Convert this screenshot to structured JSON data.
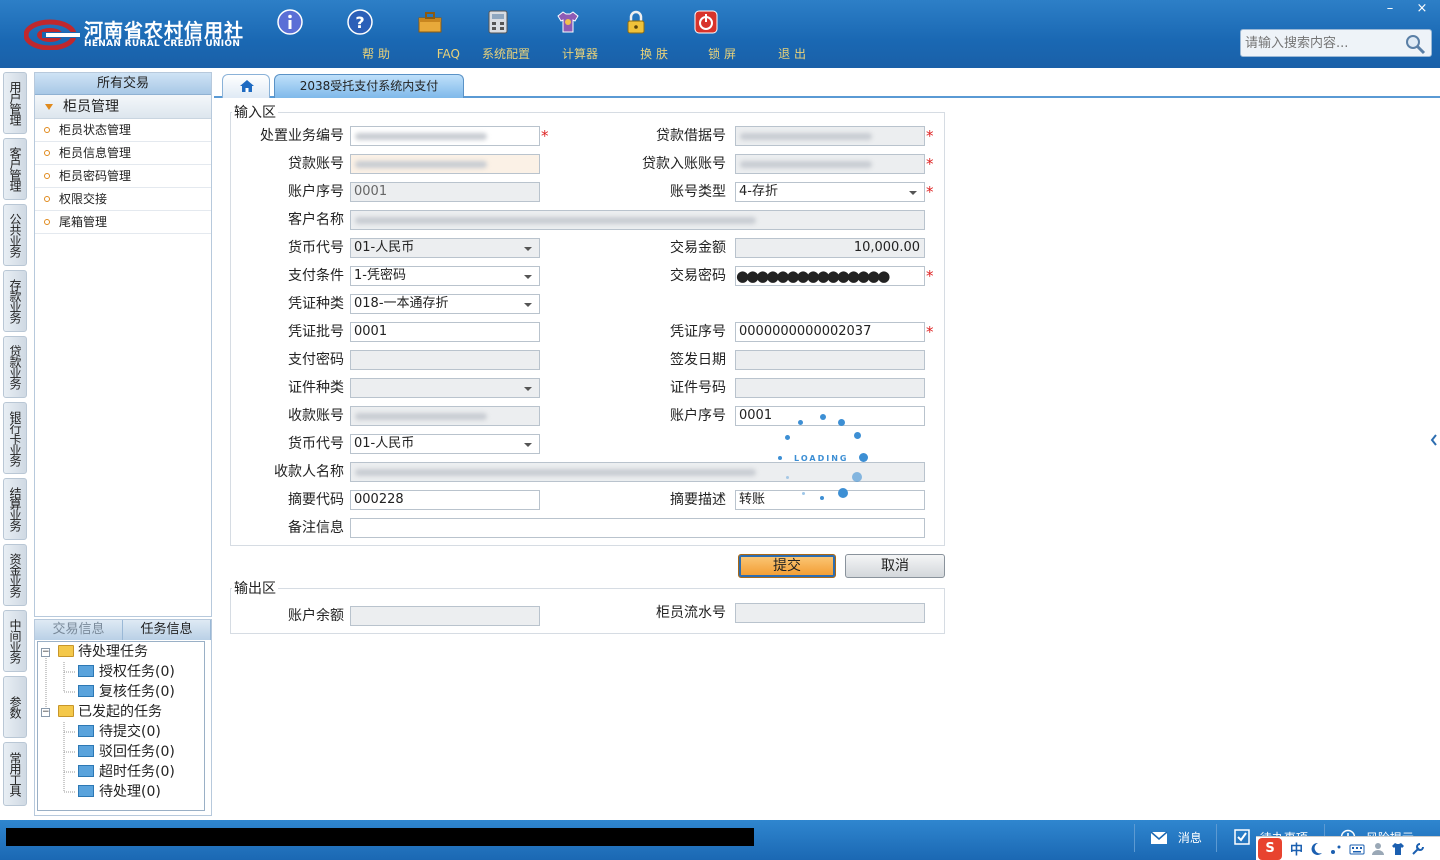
{
  "header": {
    "logo_cn": "河南省农村信用社",
    "logo_en": "HENAN RURAL CREDIT UNION",
    "toolbar": [
      {
        "label": "帮 助",
        "icon": "info-icon"
      },
      {
        "label": "FAQ",
        "icon": "question-icon"
      },
      {
        "label": "系统配置",
        "icon": "toolbox-icon"
      },
      {
        "label": "计算器",
        "icon": "calculator-icon"
      },
      {
        "label": "换 肤",
        "icon": "shirt-icon"
      },
      {
        "label": "锁 屏",
        "icon": "lock-icon"
      },
      {
        "label": "退 出",
        "icon": "power-icon"
      }
    ],
    "search_placeholder": "请输入搜索内容...",
    "window_minimize": "–",
    "window_close": "×"
  },
  "vtabs": [
    "用户管理",
    "客户管理",
    "公共业务",
    "存款业务",
    "贷款业务",
    "银行卡业务",
    "结算业务",
    "资金业务",
    "中间业务",
    "参数",
    "常用工具"
  ],
  "nav": {
    "title": "所有交易",
    "group": "柜员管理",
    "items": [
      "柜员状态管理",
      "柜员信息管理",
      "柜员密码管理",
      "权限交接",
      "尾箱管理"
    ]
  },
  "task": {
    "tabs": [
      "交易信息",
      "任务信息"
    ],
    "tree": [
      {
        "label": "待处理任务",
        "level": 0
      },
      {
        "label": "授权任务(0)",
        "level": 1
      },
      {
        "label": "复核任务(0)",
        "level": 1
      },
      {
        "label": "已发起的任务",
        "level": 0
      },
      {
        "label": "待提交(0)",
        "level": 1
      },
      {
        "label": "驳回任务(0)",
        "level": 1
      },
      {
        "label": "超时任务(0)",
        "level": 1
      },
      {
        "label": "待处理(0)",
        "level": 1
      }
    ]
  },
  "tabs": {
    "page": "2038受托支付系统内支付"
  },
  "form": {
    "input_legend": "输入区",
    "output_legend": "输出区",
    "labels": {
      "proc_no": "处置业务编号",
      "loan_receipt": "贷款借据号",
      "loan_account": "贷款账号",
      "loan_credit_account": "贷款入账账号",
      "account_seq": "账户序号",
      "account_type": "账号类型",
      "customer_name": "客户名称",
      "currency": "货币代号",
      "amount": "交易金额",
      "pay_condition": "支付条件",
      "tx_password": "交易密码",
      "voucher_type": "凭证种类",
      "voucher_batch": "凭证批号",
      "voucher_no": "凭证序号",
      "pay_password": "支付密码",
      "issue_date": "签发日期",
      "id_type": "证件种类",
      "id_no": "证件号码",
      "payee_account": "收款账号",
      "payee_seq": "账户序号",
      "payee_currency": "货币代号",
      "payee_name": "收款人名称",
      "summary_code": "摘要代码",
      "summary_desc": "摘要描述",
      "remark": "备注信息",
      "balance": "账户余额",
      "teller_serial": "柜员流水号"
    },
    "values": {
      "proc_no": "",
      "loan_receipt": "",
      "loan_account": "",
      "loan_credit_account": "",
      "account_seq": "0001",
      "account_type": "4-存折",
      "customer_name": "",
      "currency": "01-人民币",
      "amount": "10,000.00",
      "pay_condition": "1-凭密码",
      "tx_password": "●●●●●●●●●●●●●●●",
      "voucher_type": "018-一本通存折",
      "voucher_batch": "0001",
      "voucher_no": "0000000000002037",
      "pay_password": "",
      "issue_date": "",
      "id_type": "",
      "id_no": "",
      "payee_account": "",
      "payee_seq": "0001",
      "payee_currency": "01-人民币",
      "payee_name": "",
      "summary_code": "000228",
      "summary_desc": "转账",
      "remark": "",
      "balance": "",
      "teller_serial": ""
    },
    "required_mark": "*",
    "submit": "提交",
    "cancel": "取消"
  },
  "loading_text": "LOADING",
  "status": {
    "messages": "消息",
    "todo": "待办事项",
    "risk": "风险提示"
  },
  "ime": {
    "logo": "S",
    "mode": "中"
  },
  "colors": {
    "header": "#1a68b3",
    "accent_orange": "#f29a2e",
    "required": "#dd2222",
    "toolbar_label": "#e8d27a"
  }
}
